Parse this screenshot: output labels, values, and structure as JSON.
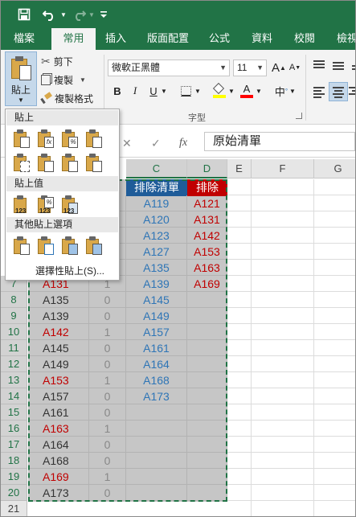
{
  "title_bar": {
    "save_icon": "save-icon",
    "undo_icon": "undo-icon",
    "redo_icon": "redo-icon",
    "customize_icon": "customize-qat-icon"
  },
  "tabs": [
    "檔案",
    "常用",
    "插入",
    "版面配置",
    "公式",
    "資料",
    "校閱",
    "檢視"
  ],
  "active_tab": "常用",
  "ribbon": {
    "paste_label": "貼上",
    "cut_label": "剪下",
    "copy_label": "複製",
    "format_painter_label": "複製格式",
    "font_name": "微軟正黑體",
    "font_size": "11",
    "bold": "B",
    "italic": "I",
    "underline": "U",
    "grow_font": "A",
    "shrink_font": "A",
    "font_color_glyph": "A",
    "phonetic_glyph": "中",
    "font_group_label": "字型"
  },
  "formula_bar": {
    "fx_label": "fx",
    "content": "原始清單",
    "cancel_glyph": "✕",
    "enter_glyph": "✓"
  },
  "columns": [
    "C",
    "D",
    "E",
    "F",
    "G"
  ],
  "rows": [
    "7",
    "8",
    "9",
    "10",
    "11",
    "12",
    "13",
    "14",
    "15",
    "16",
    "17",
    "18",
    "19",
    "20",
    "21"
  ],
  "table": {
    "header_c": "排除清單",
    "header_d": "排除",
    "col_c": [
      "A119",
      "A120",
      "A123",
      "A127",
      "A135",
      "A139",
      "A145",
      "A149",
      "A157",
      "A161",
      "A164",
      "A168",
      "A173"
    ],
    "col_d": [
      "A121",
      "A131",
      "A142",
      "A153",
      "A163",
      "A169"
    ],
    "col_a": [
      {
        "v": "A131",
        "red": true
      },
      {
        "v": "A135",
        "red": false
      },
      {
        "v": "A139",
        "red": false
      },
      {
        "v": "A142",
        "red": true
      },
      {
        "v": "A145",
        "red": false
      },
      {
        "v": "A149",
        "red": false
      },
      {
        "v": "A153",
        "red": true
      },
      {
        "v": "A157",
        "red": false
      },
      {
        "v": "A161",
        "red": false
      },
      {
        "v": "A163",
        "red": true
      },
      {
        "v": "A164",
        "red": false
      },
      {
        "v": "A168",
        "red": false
      },
      {
        "v": "A169",
        "red": true
      },
      {
        "v": "A173",
        "red": false
      }
    ],
    "col_b": [
      "1",
      "0",
      "0",
      "1",
      "0",
      "0",
      "1",
      "0",
      "0",
      "1",
      "0",
      "0",
      "1",
      "0"
    ]
  },
  "paste_menu": {
    "section_paste": "貼上",
    "section_values": "貼上值",
    "section_other": "其他貼上選項",
    "paste_special": "選擇性貼上(S)..."
  },
  "colors": {
    "excel_green": "#217346",
    "header_blue": "#1f5c99",
    "header_red": "#c00000",
    "text_blue": "#2e75b6",
    "text_red": "#c00000"
  }
}
